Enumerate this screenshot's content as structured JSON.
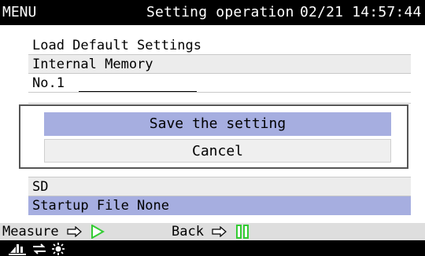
{
  "header": {
    "menu_label": "MENU",
    "title": "Setting operation",
    "datetime": "02/21 14:57:44"
  },
  "list": {
    "load_default": "Load Default Settings",
    "internal_memory": "Internal Memory",
    "no1_label": "No.1",
    "sd": "SD",
    "startup_file": "Startup File None"
  },
  "dialog": {
    "save_label": "Save the setting",
    "cancel_label": "Cancel"
  },
  "statusbar": {
    "measure_label": "Measure",
    "back_label": "Back"
  },
  "icons": {
    "measure_action": "play-icon",
    "back_action": "pause-icon",
    "bottom": [
      "connection-icon",
      "usb-icon",
      "brightness-icon"
    ]
  },
  "colors": {
    "selection": "#a6aee0",
    "play_green": "#33cc33",
    "header_bg": "#000000"
  }
}
